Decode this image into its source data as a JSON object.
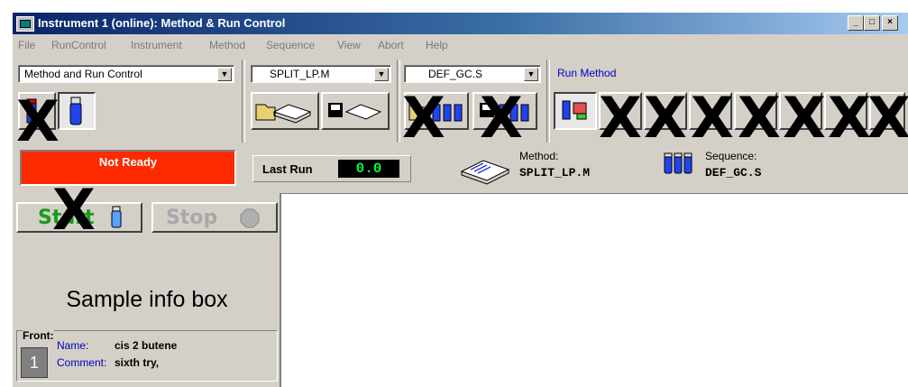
{
  "window": {
    "title": "Instrument 1 (online): Method & Run Control",
    "minimize": "_",
    "maximize": "□",
    "close": "×"
  },
  "menu": [
    "File",
    "RunControl",
    "Instrument",
    "Method",
    "Sequence",
    "View",
    "Abort",
    "Help"
  ],
  "toolbar": {
    "view_select": "Method and Run Control",
    "method_select": "SPLIT_LP.M",
    "sequence_select": "DEF_GC.S",
    "run_method_label": "Run Method",
    "dropdown_arrow": "▼"
  },
  "status": {
    "state": "Not Ready",
    "last_run_label": "Last Run",
    "last_run_value": "0.0",
    "method_label": "Method:",
    "method_value": "SPLIT_LP.M",
    "sequence_label": "Sequence:",
    "sequence_value": "DEF_GC.S"
  },
  "controls": {
    "start_label": "Start",
    "stop_label": "Stop"
  },
  "sample_info": {
    "title": "Sample info box",
    "front_label": "Front:",
    "slot_number": "1",
    "name_label": "Name:",
    "name_value": "cis 2 butene",
    "comment_label": "Comment:",
    "comment_value": "sixth try,"
  },
  "annotations": {
    "mark": "X"
  },
  "colors": {
    "not_ready_bg": "#ff2a00",
    "last_run_fg": "#00ff40",
    "run_method_fg": "#0000c0",
    "title_bar": "#0a246a"
  }
}
